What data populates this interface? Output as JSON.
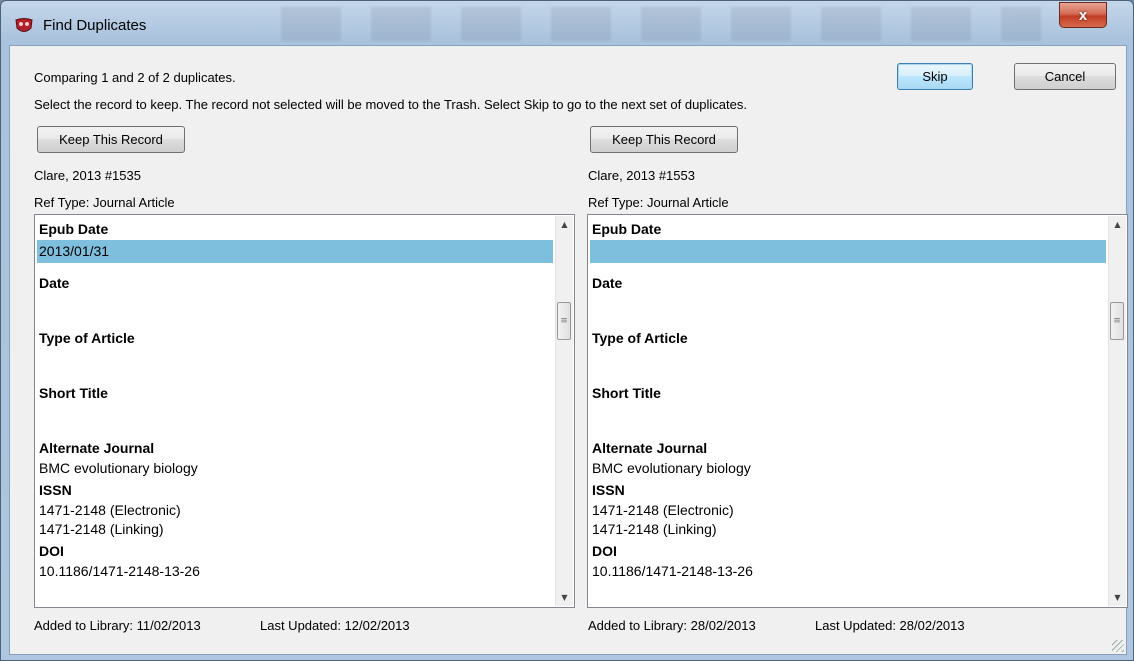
{
  "window": {
    "title": "Find Duplicates",
    "close_glyph": "x"
  },
  "header": {
    "status": "Comparing 1 and 2 of 2 duplicates.",
    "instructions": "Select the record to keep. The record not selected will be moved to the Trash. Select Skip to go to the next set of duplicates.",
    "skip_label": "Skip",
    "cancel_label": "Cancel"
  },
  "left": {
    "keep_label": "Keep This Record",
    "record": "Clare, 2013 #1535",
    "ref_type": "Ref Type: Journal Article",
    "fields": {
      "epub_date": {
        "label": "Epub Date",
        "value": "2013/01/31"
      },
      "date": {
        "label": "Date",
        "value": ""
      },
      "type_of_article": {
        "label": "Type of Article",
        "value": ""
      },
      "short_title": {
        "label": "Short Title",
        "value": ""
      },
      "alternate_journal": {
        "label": "Alternate Journal",
        "value": "BMC evolutionary biology"
      },
      "issn": {
        "label": "ISSN",
        "value1": "1471-2148 (Electronic)",
        "value2": "1471-2148 (Linking)"
      },
      "doi": {
        "label": "DOI",
        "value": "10.1186/1471-2148-13-26"
      }
    },
    "footer": {
      "added": "Added to Library: 11/02/2013",
      "updated": "Last Updated: 12/02/2013"
    }
  },
  "right": {
    "keep_label": "Keep This Record",
    "record": "Clare, 2013 #1553",
    "ref_type": "Ref Type: Journal Article",
    "fields": {
      "epub_date": {
        "label": "Epub Date",
        "value": ""
      },
      "date": {
        "label": "Date",
        "value": ""
      },
      "type_of_article": {
        "label": "Type of Article",
        "value": ""
      },
      "short_title": {
        "label": "Short Title",
        "value": ""
      },
      "alternate_journal": {
        "label": "Alternate Journal",
        "value": "BMC evolutionary biology"
      },
      "issn": {
        "label": "ISSN",
        "value1": "1471-2148 (Electronic)",
        "value2": "1471-2148 (Linking)"
      },
      "doi": {
        "label": "DOI",
        "value": "10.1186/1471-2148-13-26"
      }
    },
    "footer": {
      "added": "Added to Library: 28/02/2013",
      "updated": "Last Updated: 28/02/2013"
    }
  },
  "icons": {
    "app": "endnote-app-icon",
    "close": "close-icon",
    "scroll_up": "scroll-up-arrow-icon",
    "scroll_down": "scroll-down-arrow-icon",
    "grip": "resize-grip-icon"
  },
  "colors": {
    "selection": "#7fbfde",
    "close_button": "#c23d24",
    "default_button_border": "#3c7fb1"
  }
}
